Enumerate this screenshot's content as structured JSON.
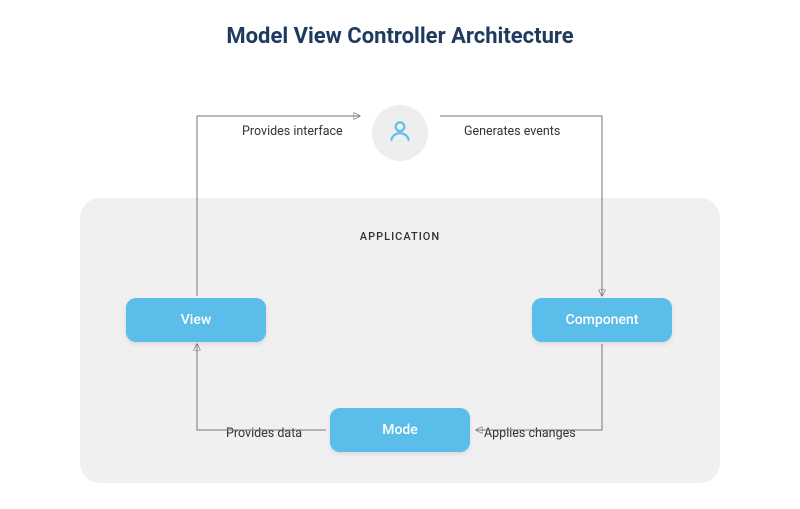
{
  "title": "Model View Controller Architecture",
  "application_label": "APPLICATION",
  "blocks": {
    "view": "View",
    "component": "Component",
    "mode": "Mode"
  },
  "edges": {
    "provides_interface": "Provides interface",
    "generates_events": "Generates events",
    "applies_changes": "Applies changes",
    "provides_data": "Provides data"
  },
  "icons": {
    "user": "user-icon"
  }
}
